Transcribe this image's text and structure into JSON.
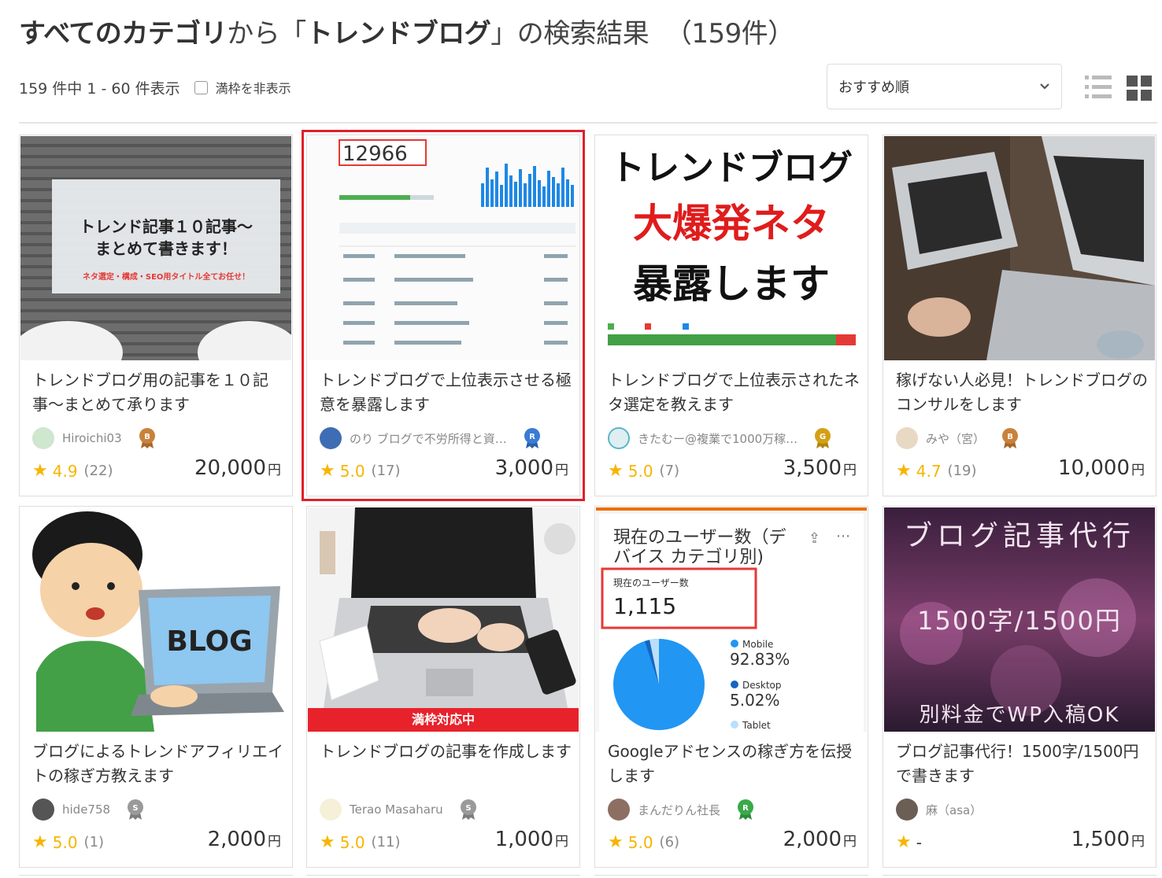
{
  "heading": {
    "category": "すべてのカテゴリ",
    "from": "から「",
    "keyword": "トレンドブログ",
    "results": "」の検索結果",
    "count": "（159件）"
  },
  "summary": {
    "range_text": "159 件中 1 - 60 件表示",
    "hide_full_label": "満枠を非表示"
  },
  "sort": {
    "selected": "おすすめ順"
  },
  "cards": [
    {
      "title": "トレンドブログ用の記事を１０記事〜まとめて承ります",
      "thumb_lines": [
        "トレンド記事１０記事〜",
        "まとめて書きます！",
        "ネタ選定・構成・SEO用タイトル全てお任せ！"
      ],
      "seller": "Hiroichi03",
      "rank": "B",
      "rank_color": "#c8823c",
      "score": "4.9",
      "reviews": "(22)",
      "price": "20,000",
      "yen": "円"
    },
    {
      "title": "トレンドブログで上位表示させる極意を暴露します",
      "thumb_lines": [
        "12966"
      ],
      "seller": "のり ブログで不労所得と資…",
      "rank": "R",
      "rank_color": "#3a7bd5",
      "score": "5.0",
      "reviews": "(17)",
      "price": "3,000",
      "yen": "円"
    },
    {
      "title": "トレンドブログで上位表示されたネタ選定を教えます",
      "thumb_lines": [
        "トレンドブログ",
        "大爆発ネタ",
        "暴露します"
      ],
      "seller": "きたむー@複業で1000万稼…",
      "rank": "G",
      "rank_color": "#d4a017",
      "score": "5.0",
      "reviews": "(7)",
      "price": "3,500",
      "yen": "円"
    },
    {
      "title": "稼げない人必見！トレンドブログのコンサルをします",
      "seller": "みや（宮）",
      "rank": "B",
      "rank_color": "#c8823c",
      "score": "4.7",
      "reviews": "(19)",
      "price": "10,000",
      "yen": "円"
    },
    {
      "title": "ブログによるトレンドアフィリエイトの稼ぎ方教えます",
      "thumb_lines": [
        "BLOG"
      ],
      "seller": "hide758",
      "rank": "S",
      "rank_color": "#9a9a9a",
      "score": "5.0",
      "reviews": "(1)",
      "price": "2,000",
      "yen": "円"
    },
    {
      "title": "トレンドブログの記事を作成します",
      "banner": "満枠対応中",
      "seller": "Terao Masaharu",
      "rank": "S",
      "rank_color": "#9a9a9a",
      "score": "5.0",
      "reviews": "(11)",
      "price": "1,000",
      "yen": "円"
    },
    {
      "title": "Googleアドセンスの稼ぎ方を伝授します",
      "thumb_lines": [
        "現在のユーザー数（デ",
        "バイス カテゴリ別)",
        "現在のユーザー数",
        "1,115",
        "Mobile",
        "92.83%",
        "Desktop",
        "5.02%",
        "Tablet"
      ],
      "seller": "まんだりん社長",
      "rank": "R",
      "rank_color": "#3aa94a",
      "score": "5.0",
      "reviews": "(6)",
      "price": "2,000",
      "yen": "円"
    },
    {
      "title": "ブログ記事代行！1500字/1500円で書きます",
      "thumb_lines": [
        "ブログ記事代行",
        "1500字/1500円",
        "別料金でWP入稿OK"
      ],
      "seller": "麻（asa）",
      "rank": "",
      "score": "-",
      "reviews": "",
      "price": "1,500",
      "yen": "円"
    }
  ]
}
